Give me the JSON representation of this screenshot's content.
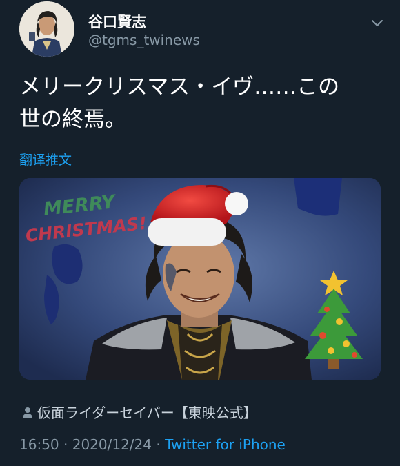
{
  "user": {
    "display_name": "谷口賢志",
    "handle": "@tgms_twinews"
  },
  "tweet": {
    "text": "メリークリスマス・イヴ……この\n世の終焉。",
    "translate_label": "翻译推文"
  },
  "media": {
    "greeting_line1": "MERRY",
    "greeting_line2": "CHRISTMAS!"
  },
  "attribution": {
    "icon": "person-icon",
    "label": "仮面ライダーセイバー【東映公式】"
  },
  "meta": {
    "time": "16:50",
    "separator": "·",
    "date": "2020/12/24",
    "source": "Twitter for iPhone"
  },
  "colors": {
    "background": "#15202b",
    "link": "#1da1f2",
    "secondary_text": "#8899a6"
  }
}
